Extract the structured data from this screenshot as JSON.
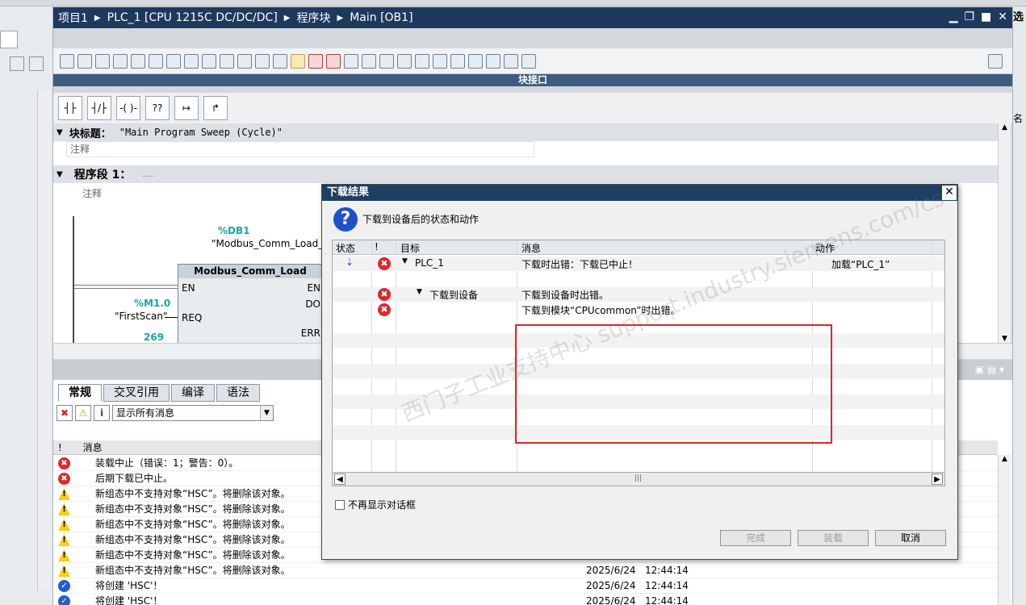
{
  "titlebar": {
    "crumbs": [
      "项目1",
      "PLC_1 [CPU 1215C DC/DC/DC]",
      "程序块",
      "Main [OB1]"
    ]
  },
  "editor": {
    "block_pane_label": "块接口",
    "block_title_label": "块标题：",
    "block_title_value": "\"Main Program Sweep (Cycle)\"",
    "comment_placeholder": "注释",
    "network_label": "程序段 1：",
    "network_dots": ".....",
    "network_comment": "注释",
    "db_addr": "%DB1",
    "db_name": "\"Modbus_Comm_Load_DB\"",
    "block_name": "Modbus_Comm_Load",
    "pin_en": "EN",
    "pin_req": "REQ",
    "pin_eno": "EN",
    "pin_done": "DO",
    "pin_error": "ERR",
    "req_addr": "%M1.0",
    "req_tag": "\"FirstScan\"",
    "num": "269"
  },
  "inspector": {
    "tabs": [
      "常规",
      "交叉引用",
      "编译",
      "语法"
    ],
    "filter": "显示所有消息",
    "msg_col_bang": "!",
    "msg_col_msg": "消息",
    "rows": [
      {
        "type": "err",
        "text": "装载中止（错误：1；警告：0）。",
        "date": "",
        "time": ""
      },
      {
        "type": "err",
        "text": "后期下载已中止。",
        "date": "",
        "time": ""
      },
      {
        "type": "warn",
        "text": "新组态中不支持对象“HSC”。将删除该对象。",
        "date": "",
        "time": ""
      },
      {
        "type": "warn",
        "text": "新组态中不支持对象“HSC”。将删除该对象。",
        "date": "",
        "time": ""
      },
      {
        "type": "warn",
        "text": "新组态中不支持对象“HSC”。将删除该对象。",
        "date": "",
        "time": ""
      },
      {
        "type": "warn",
        "text": "新组态中不支持对象“HSC”。将删除该对象。",
        "date": "",
        "time": ""
      },
      {
        "type": "warn",
        "text": "新组态中不支持对象“HSC”。将删除该对象。",
        "date": "",
        "time": ""
      },
      {
        "type": "warn",
        "text": "新组态中不支持对象“HSC”。将删除该对象。",
        "date": "2025/6/24",
        "time": "12:44:14"
      },
      {
        "type": "ok",
        "text": "将创建 'HSC'！",
        "date": "2025/6/24",
        "time": "12:44:14"
      },
      {
        "type": "ok",
        "text": "将创建 'HSC'！",
        "date": "2025/6/24",
        "time": "12:44:14"
      }
    ]
  },
  "dialog": {
    "title": "下载结果",
    "subtitle": "下载到设备后的状态和动作",
    "col_status": "状态",
    "col_bang": "!",
    "col_target": "目标",
    "col_message": "消息",
    "col_action": "动作",
    "row1_target": "PLC_1",
    "row1_message": "下载时出错：下载已中止！",
    "row1_action": "加载“PLC_1”",
    "row2_target": "下载到设备",
    "row2_message": "下载到设备时出错。",
    "row3_message": "下载到模块“CPUcommon”时出错。",
    "checkbox_label": "不再显示对话框",
    "btn_finish": "完成",
    "btn_load": "装载",
    "btn_cancel": "取消",
    "watermark": "西门子工业支持中心 support.industry.siemens.com/cs"
  },
  "rightpanel": {
    "label_top": "选",
    "label_2": "名"
  }
}
